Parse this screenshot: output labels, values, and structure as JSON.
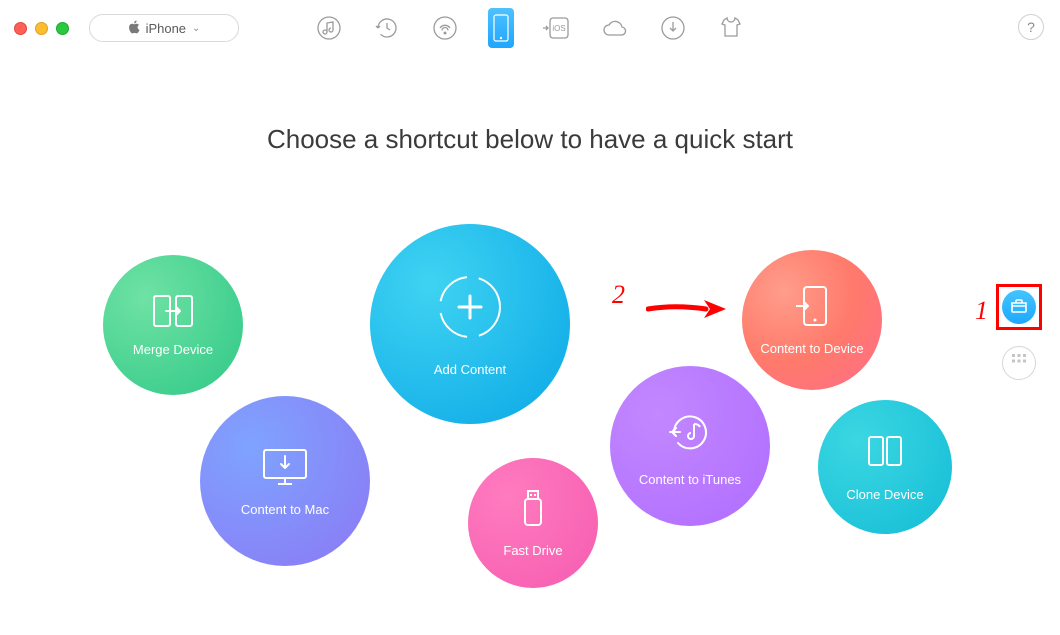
{
  "window": {
    "device_label": "iPhone"
  },
  "heading": "Choose a shortcut below to have a quick start",
  "bubbles": {
    "merge": "Merge Device",
    "add_content": "Add Content",
    "to_device": "Content to Device",
    "to_mac": "Content to Mac",
    "fast_drive": "Fast Drive",
    "to_itunes": "Content to iTunes",
    "clone": "Clone Device"
  },
  "annotations": {
    "step1": "1",
    "step2": "2"
  },
  "help_label": "?"
}
